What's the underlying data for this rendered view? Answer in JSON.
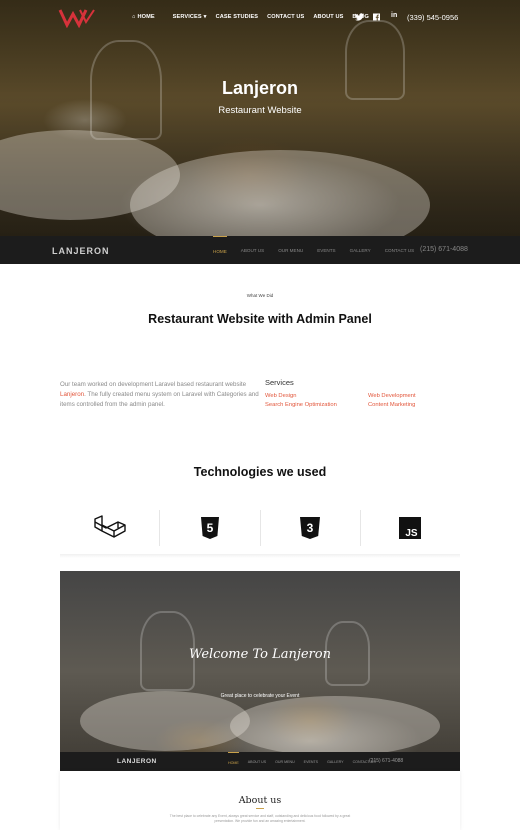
{
  "nav": {
    "items": [
      "HOME",
      "SERVICES",
      "CASE STUDIES",
      "CONTACT US",
      "ABOUT US",
      "BLOG"
    ],
    "phone": "(339) 545-0956"
  },
  "hero": {
    "title": "Lanjeron",
    "subtitle": "Restaurant Website"
  },
  "subbar": {
    "brand": "LANJERON",
    "links": [
      "HOME",
      "ABOUT US",
      "OUR MENU",
      "EVENTS",
      "GALLERY",
      "CONTACT US"
    ],
    "phone": "(215) 671-4088"
  },
  "section": {
    "eyebrow": "What We Did",
    "headline": "Restaurant Website with Admin Panel",
    "desc_before": "Our team worked on development Laravel based restaurant website ",
    "desc_link": "Lanjeron",
    "desc_after": ". The fully created menu system on Laravel with Categories and items controlled from the admin panel.",
    "services_title": "Services",
    "services": [
      "Web Design",
      "Search Engine Optimization",
      "Web Development",
      "Content Marketing"
    ]
  },
  "technologies": {
    "title": "Technologies we used",
    "items": [
      "laravel-icon",
      "html5-icon",
      "css3-icon",
      "javascript-icon"
    ],
    "js_label": "JS",
    "html_digit": "5",
    "css_digit": "3"
  },
  "preview": {
    "script_title": "Welcome To Lanjeron",
    "subtitle": "Great place to celebrate your Event",
    "brand": "LANJERON",
    "links": [
      "HOME",
      "ABOUT US",
      "OUR MENU",
      "EVENTS",
      "GALLERY",
      "CONTACT US"
    ],
    "phone": "(215) 671-4088",
    "about_title": "About us",
    "about_text": "The best place to celebrate any Event, always great service and staff, outstanding and delicious food followed by a great presentation. We provide fun and an amazing entertainment."
  },
  "colors": {
    "accent": "#e2563b",
    "gold": "#c9a14a",
    "dark_bar": "#1c1c1c"
  }
}
